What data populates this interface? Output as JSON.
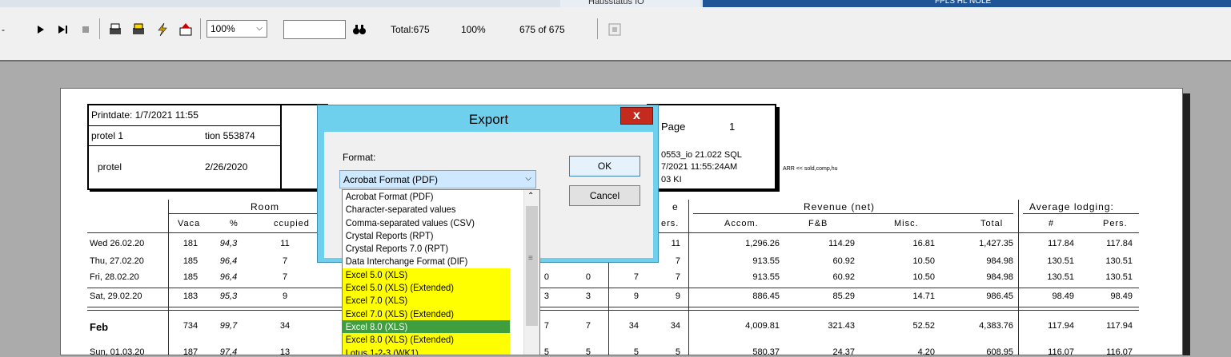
{
  "window": {
    "tab_title": "Hausstatus IO",
    "bar_text": "FPLS HL NOLE"
  },
  "toolbar": {
    "zoom": "100%",
    "total": "Total:675",
    "percent": "100%",
    "pages": "675 of 675",
    "find_value": ""
  },
  "report": {
    "header": {
      "printdate": "Printdate: 1/7/2021  11:55",
      "company": "protel 1",
      "session": "tion 553874",
      "user": "protel",
      "date": "2/26/2020",
      "page_label": "Page",
      "page_number": "1",
      "version": "0553_io 21.022  SQL",
      "run_time": "7/2021  11:55:24AM",
      "code": "03  KI",
      "arr_note": "ARR << sold,comp,hu"
    },
    "groups": {
      "room": "Room",
      "revenue": "Revenue  (net)",
      "avg": "Average lodging:",
      "e": "e"
    },
    "columns": [
      "Vaca",
      "%",
      "ccupied",
      "ers.",
      "Accom.",
      "F&B",
      "Misc.",
      "Total",
      "#",
      "Pers."
    ],
    "rows": [
      {
        "label": "Wed  26.02.20",
        "vac": "181",
        "pct": "94,3",
        "occ": "11",
        "c5": "",
        "c6": "",
        "c7": "",
        "c8": "11",
        "accom": "1,296.26",
        "fb": "114.29",
        "misc": "16.81",
        "total": "1,427.35",
        "avg": "117.84",
        "pers": "117.84"
      },
      {
        "label": "Thu,  27.02.20",
        "vac": "185",
        "pct": "96,4",
        "occ": "7",
        "c5": "",
        "c6": "",
        "c7": "",
        "c8": "7",
        "accom": "913.55",
        "fb": "60.92",
        "misc": "10.50",
        "total": "984.98",
        "avg": "130.51",
        "pers": "130.51"
      },
      {
        "label": "Fri,   28.02.20",
        "vac": "185",
        "pct": "96,4",
        "occ": "7",
        "c5": "0",
        "c6": "0",
        "c7": "7",
        "c8": "7",
        "accom": "913.55",
        "fb": "60.92",
        "misc": "10.50",
        "total": "984.98",
        "avg": "130.51",
        "pers": "130.51"
      },
      {
        "label": "Sat,  29.02.20",
        "vac": "183",
        "pct": "95,3",
        "occ": "9",
        "c5": "3",
        "c6": "3",
        "c7": "9",
        "c8": "9",
        "accom": "886.45",
        "fb": "85.29",
        "misc": "14.71",
        "total": "986.45",
        "avg": "98.49",
        "pers": "98.49"
      },
      {
        "label": "Feb",
        "vac": "734",
        "pct": "99,7",
        "occ": "34",
        "c5": "7",
        "c6": "7",
        "c7": "34",
        "c8": "34",
        "accom": "4,009.81",
        "fb": "321.43",
        "misc": "52.52",
        "total": "4,383.76",
        "avg": "117.94",
        "pers": "117.94"
      },
      {
        "label": "Sun, 01.03.20",
        "vac": "187",
        "pct": "97,4",
        "occ": "13",
        "c5": "5",
        "c6": "5",
        "c7": "5",
        "c8": "5",
        "accom": "580.37",
        "fb": "24.37",
        "misc": "4.20",
        "total": "608.95",
        "avg": "116.07",
        "pers": "116.07"
      }
    ]
  },
  "dialog": {
    "title": "Export",
    "close": "x",
    "format_label": "Format:",
    "selected": "Acrobat Format (PDF)",
    "ok": "OK",
    "cancel": "Cancel",
    "options": [
      "Acrobat Format (PDF)",
      "Character-separated values",
      "Comma-separated values (CSV)",
      "Crystal Reports (RPT)",
      "Crystal Reports 7.0 (RPT)",
      "Data Interchange Format (DIF)",
      "Excel 5.0 (XLS)",
      "Excel 5.0 (XLS) (Extended)",
      "Excel 7.0 (XLS)",
      "Excel 7.0 (XLS) (Extended)",
      "Excel 8.0 (XLS)",
      "Excel 8.0 (XLS) (Extended)",
      "Lotus 1-2-3 (WK1)"
    ]
  },
  "colors": {
    "highlight": "#ffff00",
    "dialog_frame": "#6fd0ee",
    "selection": "#3399ff"
  }
}
